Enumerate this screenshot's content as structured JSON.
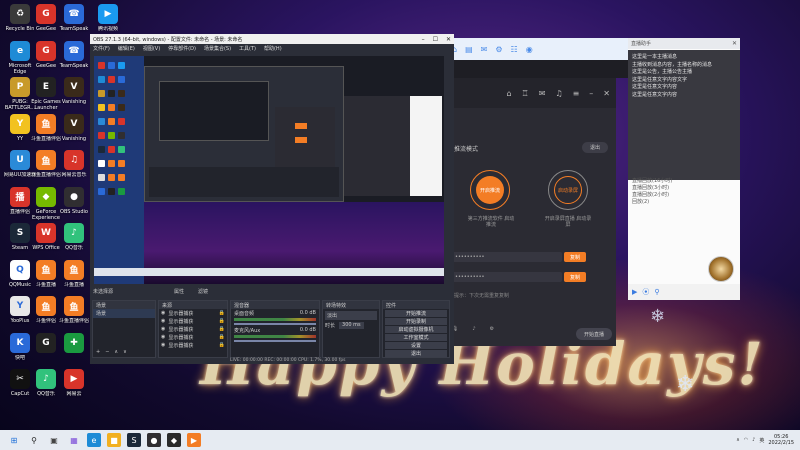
{
  "desktop": {
    "icons": [
      {
        "label": "Recycle Bin",
        "bg": "#3a3a3a",
        "glyph": "♻",
        "col": 0,
        "row": 0
      },
      {
        "label": "GeeGee",
        "bg": "#d8342a",
        "glyph": "G",
        "col": 1,
        "row": 0
      },
      {
        "label": "TeamSpeak",
        "bg": "#2a6ad8",
        "glyph": "☎",
        "col": 2,
        "row": 0
      },
      {
        "label": "腾讯视频",
        "bg": "#1a9af0",
        "glyph": "▶",
        "col": 3,
        "row": 0
      },
      {
        "label": "Microsoft Edge",
        "bg": "#1e8bd6",
        "glyph": "e",
        "col": 0,
        "row": 1
      },
      {
        "label": "GeeGee",
        "bg": "#d8342a",
        "glyph": "G",
        "col": 1,
        "row": 1
      },
      {
        "label": "TeamSpeak",
        "bg": "#2a6ad8",
        "glyph": "☎",
        "col": 2,
        "row": 1
      },
      {
        "label": "PUBG: BATTLEGR...",
        "bg": "#c89a2a",
        "glyph": "P",
        "col": 0,
        "row": 2
      },
      {
        "label": "Epic Games Launcher",
        "bg": "#222222",
        "glyph": "E",
        "col": 1,
        "row": 2
      },
      {
        "label": "Vanishing",
        "bg": "#3a2a1a",
        "glyph": "V",
        "col": 2,
        "row": 2
      },
      {
        "label": "YY",
        "bg": "#f2c220",
        "glyph": "Y",
        "col": 0,
        "row": 3
      },
      {
        "label": "斗鱼直播伴侣",
        "bg": "#f37d25",
        "glyph": "鱼",
        "col": 1,
        "row": 3
      },
      {
        "label": "Vanishing",
        "bg": "#3a2a1a",
        "glyph": "V",
        "col": 2,
        "row": 3
      },
      {
        "label": "网易UU加速器",
        "bg": "#2a8ad8",
        "glyph": "U",
        "col": 0,
        "row": 4
      },
      {
        "label": "斗鱼直播伴侣",
        "bg": "#f37d25",
        "glyph": "鱼",
        "col": 1,
        "row": 4
      },
      {
        "label": "网易云音乐",
        "bg": "#d8342a",
        "glyph": "♫",
        "col": 2,
        "row": 4
      },
      {
        "label": "直播伴侣",
        "bg": "#d8342a",
        "glyph": "播",
        "col": 0,
        "row": 5
      },
      {
        "label": "GeForce Experience",
        "bg": "#76b900",
        "glyph": "◆",
        "col": 1,
        "row": 5
      },
      {
        "label": "OBS Studio",
        "bg": "#302e31",
        "glyph": "●",
        "col": 2,
        "row": 5
      },
      {
        "label": "Steam",
        "bg": "#1b2838",
        "glyph": "S",
        "col": 0,
        "row": 6
      },
      {
        "label": "WPS Office",
        "bg": "#d8342a",
        "glyph": "W",
        "col": 1,
        "row": 6
      },
      {
        "label": "QQ音乐",
        "bg": "#31c27c",
        "glyph": "♪",
        "col": 2,
        "row": 6
      },
      {
        "label": "QQMusic",
        "bg": "#ffffff",
        "glyph": "Q",
        "col": 0,
        "row": 7
      },
      {
        "label": "斗鱼直播",
        "bg": "#f37d25",
        "glyph": "鱼",
        "col": 1,
        "row": 7
      },
      {
        "label": "斗鱼直播",
        "bg": "#f37d25",
        "glyph": "鱼",
        "col": 2,
        "row": 7
      },
      {
        "label": "YooPlus",
        "bg": "#e8e8e8",
        "glyph": "Y",
        "col": 0,
        "row": 8
      },
      {
        "label": "斗鱼伴侣",
        "bg": "#f37d25",
        "glyph": "鱼",
        "col": 1,
        "row": 8
      },
      {
        "label": "斗鱼直播伴侣",
        "bg": "#f37d25",
        "glyph": "鱼",
        "col": 2,
        "row": 8
      },
      {
        "label": "快吧",
        "bg": "#2a6ad8",
        "glyph": "K",
        "col": 0,
        "row": 9
      },
      {
        "label": "",
        "bg": "#222222",
        "glyph": "G",
        "col": 1,
        "row": 9
      },
      {
        "label": "",
        "bg": "#1a9a40",
        "glyph": "✚",
        "col": 2,
        "row": 9
      },
      {
        "label": "CapCut",
        "bg": "#111111",
        "glyph": "✂",
        "col": 0,
        "row": 10
      },
      {
        "label": "QQ音乐",
        "bg": "#31c27c",
        "glyph": "♪",
        "col": 1,
        "row": 10
      },
      {
        "label": "网易云",
        "bg": "#d8342a",
        "glyph": "▶",
        "col": 2,
        "row": 10
      }
    ],
    "wallpaper_text": "Happy Holidays!"
  },
  "obs": {
    "title": "OBS 27.1.3 (64-bit, windows) - 配置文件: 未命名 - 场景: 未命名",
    "menu": [
      "文件(F)",
      "编辑(E)",
      "视图(V)",
      "停靠部件(D)",
      "场景集合(S)",
      "工具(T)",
      "帮助(H)"
    ],
    "sections": {
      "scenes_hdr": "场景",
      "sources_hdr": "来源",
      "mixer_hdr": "混音器",
      "transitions_hdr": "转场特效",
      "controls_hdr": "控件"
    },
    "info_bar": "未选择源",
    "filter_label": "属性",
    "filters_label": "滤镜",
    "scene_item": "场景",
    "sources": [
      "显示器捕获",
      "显示器捕获",
      "显示器捕获",
      "显示器捕获",
      "显示器捕获"
    ],
    "mixer": [
      {
        "name": "桌面音频",
        "db": "0.0 dB"
      },
      {
        "name": "麦克风/Aux",
        "db": "0.0 dB"
      }
    ],
    "transition": {
      "type": "淡出",
      "duration_label": "时长",
      "duration": "300 ms"
    },
    "controls": [
      "开始推流",
      "开始录制",
      "启动虚拟摄像机",
      "工作室模式",
      "设置",
      "退出"
    ],
    "status": "LIVE: 00:00:00   REC: 00:00:00   CPU: 1.7%, 30.00 fps"
  },
  "darkapp": {
    "mode_label": "推流模式",
    "exit_label": "退出",
    "circle1": "开启推流",
    "circle2": "启动录屏",
    "cap1": "第三方推流软件\n启动推流",
    "cap2": "开启录屏直播\n启动录屏",
    "copy1": "复制",
    "copy2": "复制",
    "tip": "提示：下次无需重复复制",
    "ctrl": [
      "麦克风",
      "扬声器",
      "设置"
    ],
    "start": "开始直播"
  },
  "chat": {
    "title": "直播助手",
    "notice": "这里是一本主播消息\n主播收到消息内容，主播名称的消息\n这里是公告，主播公告主播\n这里是任意文字内容文字\n这里是任意文字内容\n这里是任意文字内容",
    "list": [
      "直播回放(16小时)",
      "直播回放(3小时)",
      "直播回放(2小时)",
      "回放(2)"
    ]
  },
  "taskbar": {
    "apps": [
      {
        "glyph": "⊞",
        "bg": "#e6ebf2",
        "color": "#1e6fd8"
      },
      {
        "glyph": "⚲",
        "bg": "#e6ebf2",
        "color": "#222"
      },
      {
        "glyph": "▣",
        "bg": "#e6ebf2",
        "color": "#444"
      },
      {
        "glyph": "▦",
        "bg": "#e6ebf2",
        "color": "#7a4ad8"
      },
      {
        "glyph": "e",
        "bg": "#1e8bd6",
        "color": "#fff"
      },
      {
        "glyph": "■",
        "bg": "#f2b020",
        "color": "#fff"
      },
      {
        "glyph": "S",
        "bg": "#1b2838",
        "color": "#fff"
      },
      {
        "glyph": "●",
        "bg": "#302e31",
        "color": "#fff"
      },
      {
        "glyph": "◆",
        "bg": "#2a2a2a",
        "color": "#fff"
      },
      {
        "glyph": "▶",
        "bg": "#f37d25",
        "color": "#fff"
      }
    ],
    "time": "05:26",
    "date": "2022/2/15",
    "lang": "英"
  }
}
